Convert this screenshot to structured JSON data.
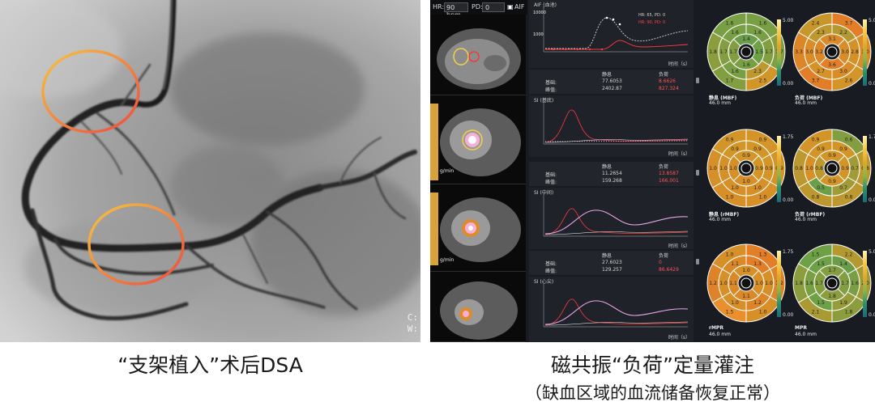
{
  "left_panel": {
    "corner_text": [
      "C:",
      "W:"
    ],
    "caption": "“支架植入”术后DSA"
  },
  "right_panel": {
    "toolbar": {
      "hr_label": "HR:",
      "hr_value": "90 bpm",
      "pd_label": "PD:",
      "pd_value": "0",
      "aif_label": "AIF"
    },
    "curves": [
      {
        "title": "AIF (血池)",
        "y_ticks": [
          "10000",
          "1000"
        ],
        "x_ticks": [
          "0",
          "10",
          "20",
          "30",
          "40",
          "50"
        ],
        "time_label": "时间（s）",
        "legend": [
          {
            "text": "HR: 65, PD: 0",
            "color": "#d0d0d0"
          },
          {
            "text": "HR: 90, PD: 0",
            "color": "#ff4444"
          }
        ]
      },
      {
        "title": "SI (基底)",
        "y_ticks": [
          "1500",
          "1000",
          "500"
        ],
        "x_ticks": [
          "0",
          "10",
          "20",
          "30",
          "40",
          "50"
        ],
        "time_label": "时间（s）"
      },
      {
        "title": "SI (中间)",
        "y_ticks": [
          "1000",
          "500"
        ],
        "x_ticks": [
          "0",
          "10",
          "20",
          "30",
          "40",
          "50"
        ],
        "time_label": "时间（s）"
      },
      {
        "title": "SI (心尖)",
        "y_ticks": [
          "1000",
          "500"
        ],
        "x_ticks": [
          "0",
          "10",
          "20",
          "30",
          "40",
          "50"
        ],
        "time_label": "时间（s）"
      }
    ],
    "stats": [
      {
        "col_labels": [
          "静息",
          "负荷"
        ],
        "row_labels": [
          "基础:",
          "峰值:"
        ],
        "rest": [
          "77.6053",
          "2402.87"
        ],
        "stress": [
          "8.6626",
          "827.324"
        ]
      },
      {
        "col_labels": [
          "静息",
          "负荷"
        ],
        "row_labels": [
          "基础:",
          "峰值:"
        ],
        "rest": [
          "11.2654",
          "159.268"
        ],
        "stress": [
          "13.8587",
          "166.001"
        ]
      },
      {
        "col_labels": [
          "静息",
          "负荷"
        ],
        "row_labels": [
          "基础:",
          "峰值:"
        ],
        "rest": [
          "27.6023",
          "129.257"
        ],
        "stress": [
          "0",
          "86.6429"
        ]
      }
    ],
    "slice_units": [
      "g/min",
      "g/min"
    ],
    "bullseye_maps": [
      {
        "label": "静息 (MBF)",
        "size": "46.0 mm",
        "scale_max": "5.00",
        "scale_min": "0.00",
        "values": [
          "1.6",
          "1.6",
          "1.7",
          "2.5",
          "1.7",
          "1.8",
          "1.6",
          "1.6",
          "1.7",
          "2.3",
          "1.6",
          "1.7",
          "1.4",
          "1.5",
          "1.6",
          "1.7"
        ]
      },
      {
        "label": "负荷 (MBF)",
        "size": "46.0 mm",
        "scale_max": "5.00",
        "scale_min": "0.00",
        "values": [
          "2.4",
          "3.7",
          "3.0",
          "2.6",
          "3.7",
          "3.3",
          "2.3",
          "2.2",
          "2.8",
          "3.0",
          "2.7",
          "3.0",
          "3.1",
          "3.0",
          "3.6",
          "3.2"
        ]
      },
      {
        "label": "静息 (rMBF)",
        "size": "46.0 mm",
        "scale_max": "1.75",
        "scale_min": "0.00",
        "values": [
          "0.9",
          "0.9",
          "0.9",
          "1.0",
          "1.0",
          "1.0",
          "0.9",
          "0.9",
          "0.9",
          "1.0",
          "1.0",
          "1.0",
          "0.9",
          "0.9",
          "1.0",
          "1.0"
        ]
      },
      {
        "label": "负荷 (rMBF)",
        "size": "46.0 mm",
        "scale_max": "1.75",
        "scale_min": "0.00",
        "values": [
          "0.9",
          "0.6",
          "0.8",
          "0.8",
          "0.8",
          "0.8",
          "0.9",
          "0.9",
          "0.7",
          "0.7",
          "0.5",
          "1.0",
          "0.9",
          "0.9",
          "0.9",
          "0.8"
        ]
      },
      {
        "label": "rMPR",
        "size": "46.0 mm",
        "scale_max": "1.75",
        "scale_min": "0.00",
        "values": [
          "1.0",
          "1.3",
          "1.2",
          "1.0",
          "1.5",
          "1.2",
          "1.1",
          "1.3",
          "1.0",
          "1.2",
          "1.0",
          "1.0",
          "1.0",
          "1.0",
          "1.1",
          "1.1"
        ]
      },
      {
        "label": "MPR",
        "size": "46.0 mm",
        "scale_max": "5.00",
        "scale_min": "0.00",
        "values": [
          "1.5",
          "2.2",
          "2.0",
          "1.8",
          "2.1",
          "1.8",
          "1.5",
          "1.4",
          "1.6",
          "1.9",
          "1.5",
          "1.6",
          "1.7",
          "1.7",
          "1.8",
          "1.7"
        ]
      }
    ],
    "caption_line1": "磁共振“负荷”定量灌注",
    "caption_line2": "（缺血区域的血流储备恢复正常）"
  },
  "colors": {
    "roi_ring_gradient": [
      "#f4c542",
      "#ef4a3f"
    ],
    "rest_curve": "#d8d8d8",
    "stress_curve": "#ff3b3b",
    "stress_series": "#e8a5e8"
  }
}
